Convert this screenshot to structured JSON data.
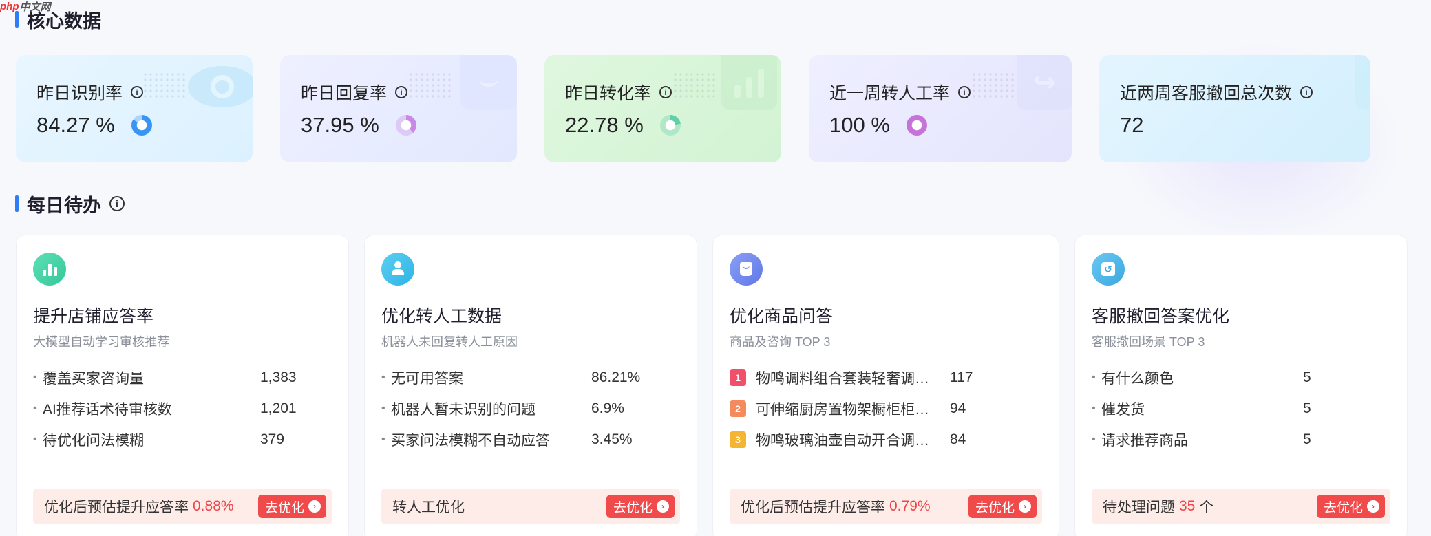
{
  "watermark": {
    "brand": "php",
    "text": "中文网"
  },
  "core": {
    "title": "核心数据",
    "cards": [
      {
        "label": "昨日识别率",
        "value": "84.27 %",
        "ring_percent": 84.27,
        "ring_color": "#3a95f2",
        "icon": "eye-icon"
      },
      {
        "label": "昨日回复率",
        "value": "37.95 %",
        "ring_percent": 37.95,
        "ring_color": "#c889e6",
        "icon": "chat-bubble-icon"
      },
      {
        "label": "昨日转化率",
        "value": "22.78 %",
        "ring_percent": 22.78,
        "ring_color": "#5fd0a8",
        "icon": "bar-chart-icon"
      },
      {
        "label": "近一周转人工率",
        "value": "100 %",
        "ring_percent": 100,
        "ring_color": "#c673d9",
        "icon": "forward-arrow-icon"
      },
      {
        "label": "近两周客服撤回总次数",
        "value": "72",
        "icon": "chat-bubble-icon"
      }
    ]
  },
  "daily": {
    "title": "每日待办",
    "cards": [
      {
        "title": "提升店铺应答率",
        "subtitle": "大模型自动学习审核推荐",
        "items": [
          {
            "label": "覆盖买家咨询量",
            "value": "1,383"
          },
          {
            "label": "AI推荐话术待审核数",
            "value": "1,201"
          },
          {
            "label": "待优化问法模糊",
            "value": "379"
          }
        ],
        "bar_text": "优化后预估提升应答率",
        "bar_highlight": "0.88%",
        "bar_suffix": "",
        "button": "去优化"
      },
      {
        "title": "优化转人工数据",
        "subtitle": "机器人未回复转人工原因",
        "items": [
          {
            "label": "无可用答案",
            "value": "86.21%"
          },
          {
            "label": "机器人暂未识别的问题",
            "value": "6.9%"
          },
          {
            "label": "买家问法模糊不自动应答",
            "value": "3.45%"
          }
        ],
        "bar_text": "转人工优化",
        "bar_highlight": "",
        "bar_suffix": "",
        "button": "去优化"
      },
      {
        "title": "优化商品问答",
        "subtitle": "商品及咨询 TOP 3",
        "items": [
          {
            "rank": "1",
            "label": "物鸣调料组合套装轻奢调…",
            "value": "117"
          },
          {
            "rank": "2",
            "label": "可伸缩厨房置物架橱柜柜…",
            "value": "94"
          },
          {
            "rank": "3",
            "label": "物鸣玻璃油壶自动开合调…",
            "value": "84"
          }
        ],
        "bar_text": "优化后预估提升应答率",
        "bar_highlight": "0.79%",
        "bar_suffix": "",
        "button": "去优化"
      },
      {
        "title": "客服撤回答案优化",
        "subtitle": "客服撤回场景 TOP 3",
        "items": [
          {
            "label": "有什么颜色",
            "value": "5"
          },
          {
            "label": "催发货",
            "value": "5"
          },
          {
            "label": "请求推荐商品",
            "value": "5"
          }
        ],
        "bar_text": "待处理问题",
        "bar_highlight": "35",
        "bar_suffix": "个",
        "button": "去优化"
      }
    ]
  },
  "colors": {
    "accent_blue": "#2f7df6",
    "highlight_red": "#f0444a",
    "button_red": "#f04a4a",
    "bar_bg": "#fdece7",
    "rank_1": "#f0506a",
    "rank_2": "#f58a5c",
    "rank_3": "#f5b533"
  }
}
